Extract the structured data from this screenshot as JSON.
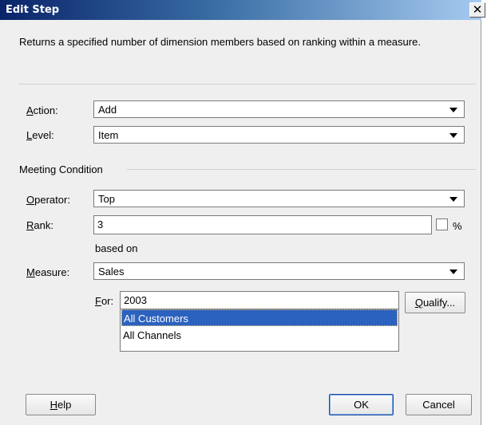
{
  "window": {
    "title": "Edit Step",
    "close_glyph": "✕"
  },
  "description": "Returns a specified number of dimension members based on ranking within a measure.",
  "action": {
    "label_key": "A",
    "label_rest": "ction:",
    "value": "Add"
  },
  "level": {
    "label_key": "L",
    "label_rest": "evel:",
    "value": "Item"
  },
  "meeting_condition": {
    "label": "Meeting Condition"
  },
  "operator": {
    "label_key": "O",
    "label_rest": "perator:",
    "value": "Top"
  },
  "rank": {
    "label_key": "R",
    "label_rest": "ank:",
    "value": "3",
    "percent_label": "%",
    "percent_checked": false
  },
  "based_on": "based on",
  "measure": {
    "label_key": "M",
    "label_rest": "easure:",
    "value": "Sales"
  },
  "for": {
    "label_key": "F",
    "label_rest": "or:",
    "items": [
      "2003",
      "All Customers",
      "All Channels"
    ],
    "selected_index": 1
  },
  "buttons": {
    "qualify": {
      "key": "Q",
      "rest": "ualify..."
    },
    "help": {
      "key": "H",
      "rest": "elp"
    },
    "ok": "OK",
    "cancel": "Cancel"
  }
}
